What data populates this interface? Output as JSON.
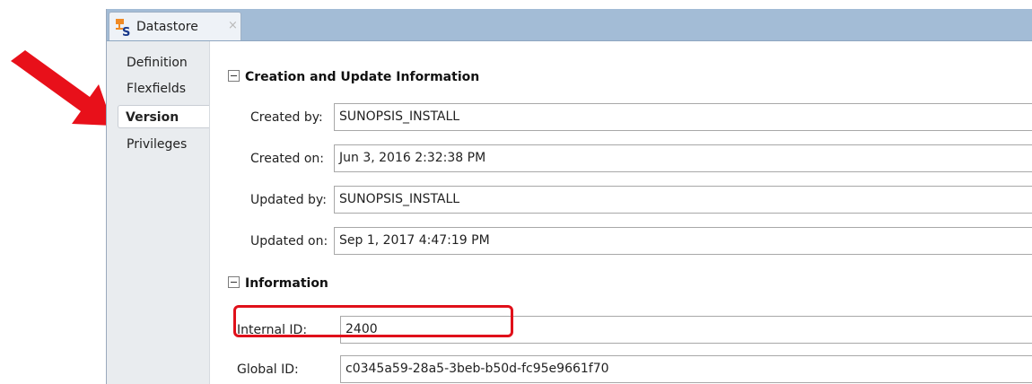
{
  "editor_tab": {
    "title": "Datastore",
    "close_glyph": "×",
    "icon": "datastore-icon"
  },
  "side_nav": {
    "items": [
      {
        "label": "Definition",
        "active": false
      },
      {
        "label": "Flexfields",
        "active": false
      },
      {
        "label": "Version",
        "active": true
      },
      {
        "label": "Privileges",
        "active": false
      }
    ]
  },
  "sections": {
    "creation": {
      "title": "Creation and Update Information",
      "created_by_label": "Created by:",
      "created_by_value": "SUNOPSIS_INSTALL",
      "created_on_label": "Created on:",
      "created_on_value": "Jun 3, 2016 2:32:38 PM",
      "updated_by_label": "Updated by:",
      "updated_by_value": "SUNOPSIS_INSTALL",
      "updated_on_label": "Updated on:",
      "updated_on_value": "Sep 1, 2017 4:47:19 PM"
    },
    "information": {
      "title": "Information",
      "internal_id_label": "Internal ID:",
      "internal_id_value": "2400",
      "global_id_label": "Global ID:",
      "global_id_value": "c0345a59-28a5-3beb-b50d-fc95e9661f70"
    }
  },
  "annotations": {
    "arrow_color": "#e8101a",
    "highlight_color": "#e0101a"
  }
}
